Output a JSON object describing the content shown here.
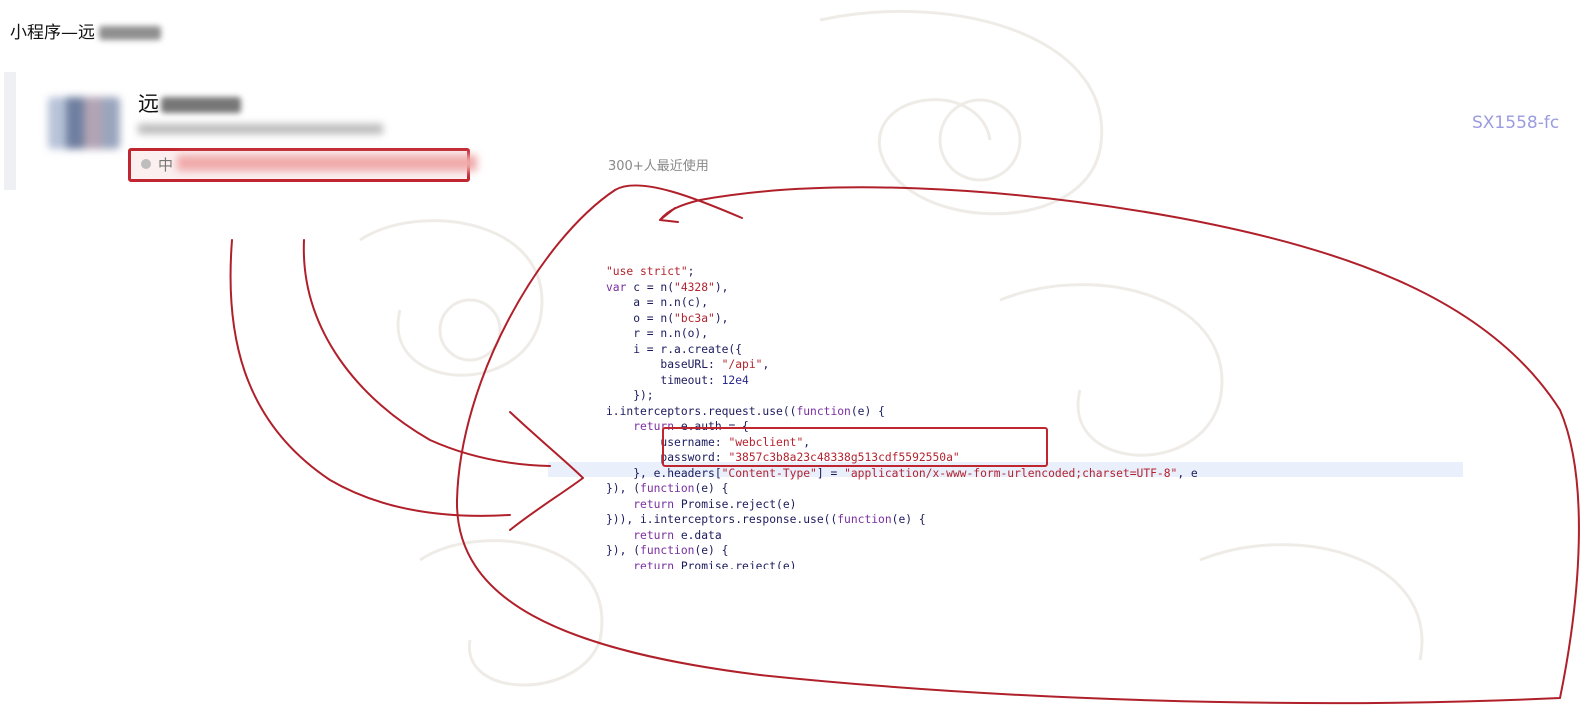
{
  "page": {
    "title": "小程序—远",
    "users_label": "300+人最近使用",
    "side_code": "SX1558-fc"
  },
  "card": {
    "name": "远",
    "tag_label": "中"
  },
  "code": {
    "lines": [
      [
        {
          "t": "\"use strict\"",
          "c": "str"
        },
        {
          "t": ";"
        }
      ],
      [
        {
          "t": "var ",
          "c": "kw"
        },
        {
          "t": "c = n("
        },
        {
          "t": "\"4328\"",
          "c": "str"
        },
        {
          "t": "),"
        }
      ],
      [
        {
          "t": "    a = n.n(c),"
        }
      ],
      [
        {
          "t": "    o = n("
        },
        {
          "t": "\"bc3a\"",
          "c": "str"
        },
        {
          "t": "),"
        }
      ],
      [
        {
          "t": "    r = n.n(o),"
        }
      ],
      [
        {
          "t": "    i = r.a.create({"
        }
      ],
      [
        {
          "t": "        baseURL: "
        },
        {
          "t": "\"/api\"",
          "c": "str"
        },
        {
          "t": ","
        }
      ],
      [
        {
          "t": "        timeout: "
        },
        {
          "t": "12e4",
          "c": "num"
        }
      ],
      [
        {
          "t": "    });"
        }
      ],
      [
        {
          "t": "i.interceptors.request.use(("
        },
        {
          "t": "function",
          "c": "kw"
        },
        {
          "t": "(e) {"
        }
      ],
      [
        {
          "t": "    "
        },
        {
          "t": "return",
          "c": "kw"
        },
        {
          "t": " e.auth = {"
        }
      ],
      [
        {
          "t": "        username: "
        },
        {
          "t": "\"webclient\"",
          "c": "str"
        },
        {
          "t": ","
        }
      ],
      [
        {
          "t": "        password: "
        },
        {
          "t": "\"3857c3b8a23c48338g513cdf5592550a\"",
          "c": "str"
        }
      ],
      [
        {
          "t": "    }, e.headers["
        },
        {
          "t": "\"Content-Type\"",
          "c": "str"
        },
        {
          "t": "] = "
        },
        {
          "t": "\"application/x-www-form-urlencoded;charset=UTF-8\"",
          "c": "str"
        },
        {
          "t": ", e"
        }
      ],
      [
        {
          "t": "}), ("
        },
        {
          "t": "function",
          "c": "kw"
        },
        {
          "t": "(e) {"
        }
      ],
      [
        {
          "t": "    "
        },
        {
          "t": "return",
          "c": "kw"
        },
        {
          "t": " Promise.reject(e)"
        }
      ],
      [
        {
          "t": "})), i.interceptors.response.use(("
        },
        {
          "t": "function",
          "c": "kw"
        },
        {
          "t": "(e) {"
        }
      ],
      [
        {
          "t": "    "
        },
        {
          "t": "return",
          "c": "kw"
        },
        {
          "t": " e.data"
        }
      ],
      [
        {
          "t": "}), ("
        },
        {
          "t": "function",
          "c": "kw"
        },
        {
          "t": "(e) {"
        }
      ],
      [
        {
          "t": "    "
        },
        {
          "t": "return",
          "c": "kw"
        },
        {
          "t": " Promise.reject(e)"
        }
      ]
    ]
  },
  "colors": {
    "annotation_red": "#b0202a",
    "code_text": "#1b1b5e",
    "code_string": "#b3242f",
    "code_keyword": "#7a2ea0"
  }
}
